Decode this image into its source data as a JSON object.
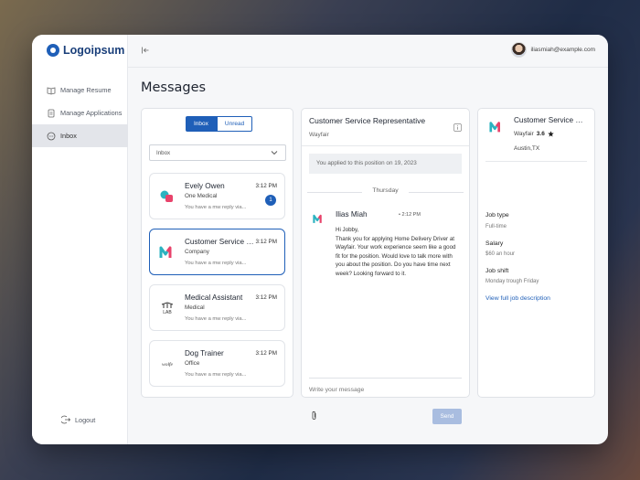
{
  "brand": {
    "name": "Logoipsum"
  },
  "sidebar": {
    "items": [
      {
        "label": "Manage Resume",
        "icon": "book-icon"
      },
      {
        "label": "Manage Applications",
        "icon": "document-icon"
      },
      {
        "label": "Inbox",
        "icon": "chat-icon",
        "active": true
      }
    ],
    "logout_label": "Logout"
  },
  "header": {
    "user_email": "iliasmiah@example.com"
  },
  "page": {
    "title": "Messages"
  },
  "inbox": {
    "tabs": [
      {
        "label": "Inbox",
        "active": true
      },
      {
        "label": "Unread",
        "active": false
      }
    ],
    "filter_value": "Inbox",
    "conversations": [
      {
        "title": "Evely Owen",
        "time": "3:12 PM",
        "subtitle": "One Medical",
        "preview": "You have a mw reply via...",
        "unread": "1"
      },
      {
        "title": "Customer Service Representative",
        "time": "3:12 PM",
        "subtitle": "Company",
        "preview": "You have a mw reply via..."
      },
      {
        "title": "Medical Assistant",
        "time": "3:12 PM",
        "subtitle": "Medical",
        "preview": "You have a mw reply via...",
        "logo_text": "LAB"
      },
      {
        "title": "Dog Trainer",
        "time": "3:12 PM",
        "subtitle": "Office",
        "preview": "You have a mw reply via...",
        "logo_text": "wolfe"
      }
    ]
  },
  "chat": {
    "title": "Customer Service Representative",
    "company": "Wayfair",
    "applied_note": "You applied to this position on 19, 2023",
    "day_separator": "Thursday",
    "message": {
      "sender": "Ilias Miah",
      "time": "• 2:12 PM",
      "body": "Hi Jobby,\nThank you for applying Home Delivery Driver at Wayfair. Your work experience seem like a good fit for the position. Would love to talk more with you about the position. Do you have time next week? Looking forward to it."
    },
    "compose_placeholder": "Write your message",
    "send_label": "Send"
  },
  "details": {
    "title": "Customer Service Representative",
    "company": "Wayfair",
    "rating": "3.6",
    "location": "Austin,TX",
    "job_type_label": "Job type",
    "job_type": "Full-time",
    "salary_label": "Salary",
    "salary": "$60 an hour",
    "shift_label": "Job shift",
    "shift": "Monday trough Friday",
    "link_label": "View full job description"
  },
  "colors": {
    "accent": "#1f5fb8",
    "send_disabled": "#a9bde0",
    "brand_pink": "#e8436b",
    "brand_teal": "#2bb3c0"
  }
}
